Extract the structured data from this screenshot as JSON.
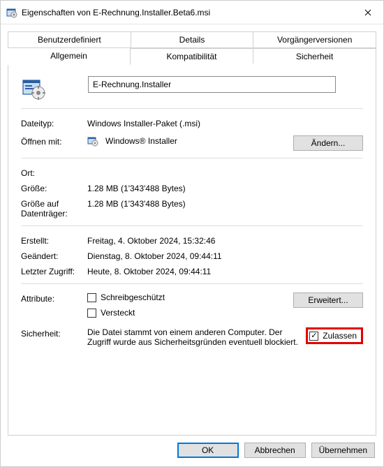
{
  "title": "Eigenschaften von E-Rechnung.Installer.Beta6.msi",
  "tabs_row1": {
    "user": "Benutzerdefiniert",
    "details": "Details",
    "prev": "Vorgängerversionen"
  },
  "tabs_row2": {
    "general": "Allgemein",
    "compat": "Kompatibilität",
    "security": "Sicherheit"
  },
  "name_value": "E-Rechnung.Installer",
  "labels": {
    "filetype": "Dateityp:",
    "openwith": "Öffnen mit:",
    "location": "Ort:",
    "size": "Größe:",
    "size_on_disk": "Größe auf Datenträger:",
    "created": "Erstellt:",
    "modified": "Geändert:",
    "accessed": "Letzter Zugriff:",
    "attributes": "Attribute:",
    "securitylbl": "Sicherheit:"
  },
  "values": {
    "filetype": "Windows Installer-Paket (.msi)",
    "openwith": "Windows® Installer",
    "location": "",
    "size": "1.28 MB (1'343'488 Bytes)",
    "size_on_disk": "1.28 MB (1'343'488 Bytes)",
    "created": "Freitag, 4. Oktober 2024, 15:32:46",
    "modified": "Dienstag, 8. Oktober 2024, 09:44:11",
    "accessed": "Heute, 8. Oktober 2024, 09:44:11"
  },
  "buttons": {
    "change": "Ändern...",
    "advanced": "Erweitert...",
    "ok": "OK",
    "cancel": "Abbrechen",
    "apply": "Übernehmen"
  },
  "checkboxes": {
    "readonly": "Schreibgeschützt",
    "hidden": "Versteckt",
    "unblock": "Zulassen"
  },
  "security_text": "Die Datei stammt von einem anderen Computer. Der Zugriff wurde aus Sicherheitsgründen eventuell blockiert."
}
